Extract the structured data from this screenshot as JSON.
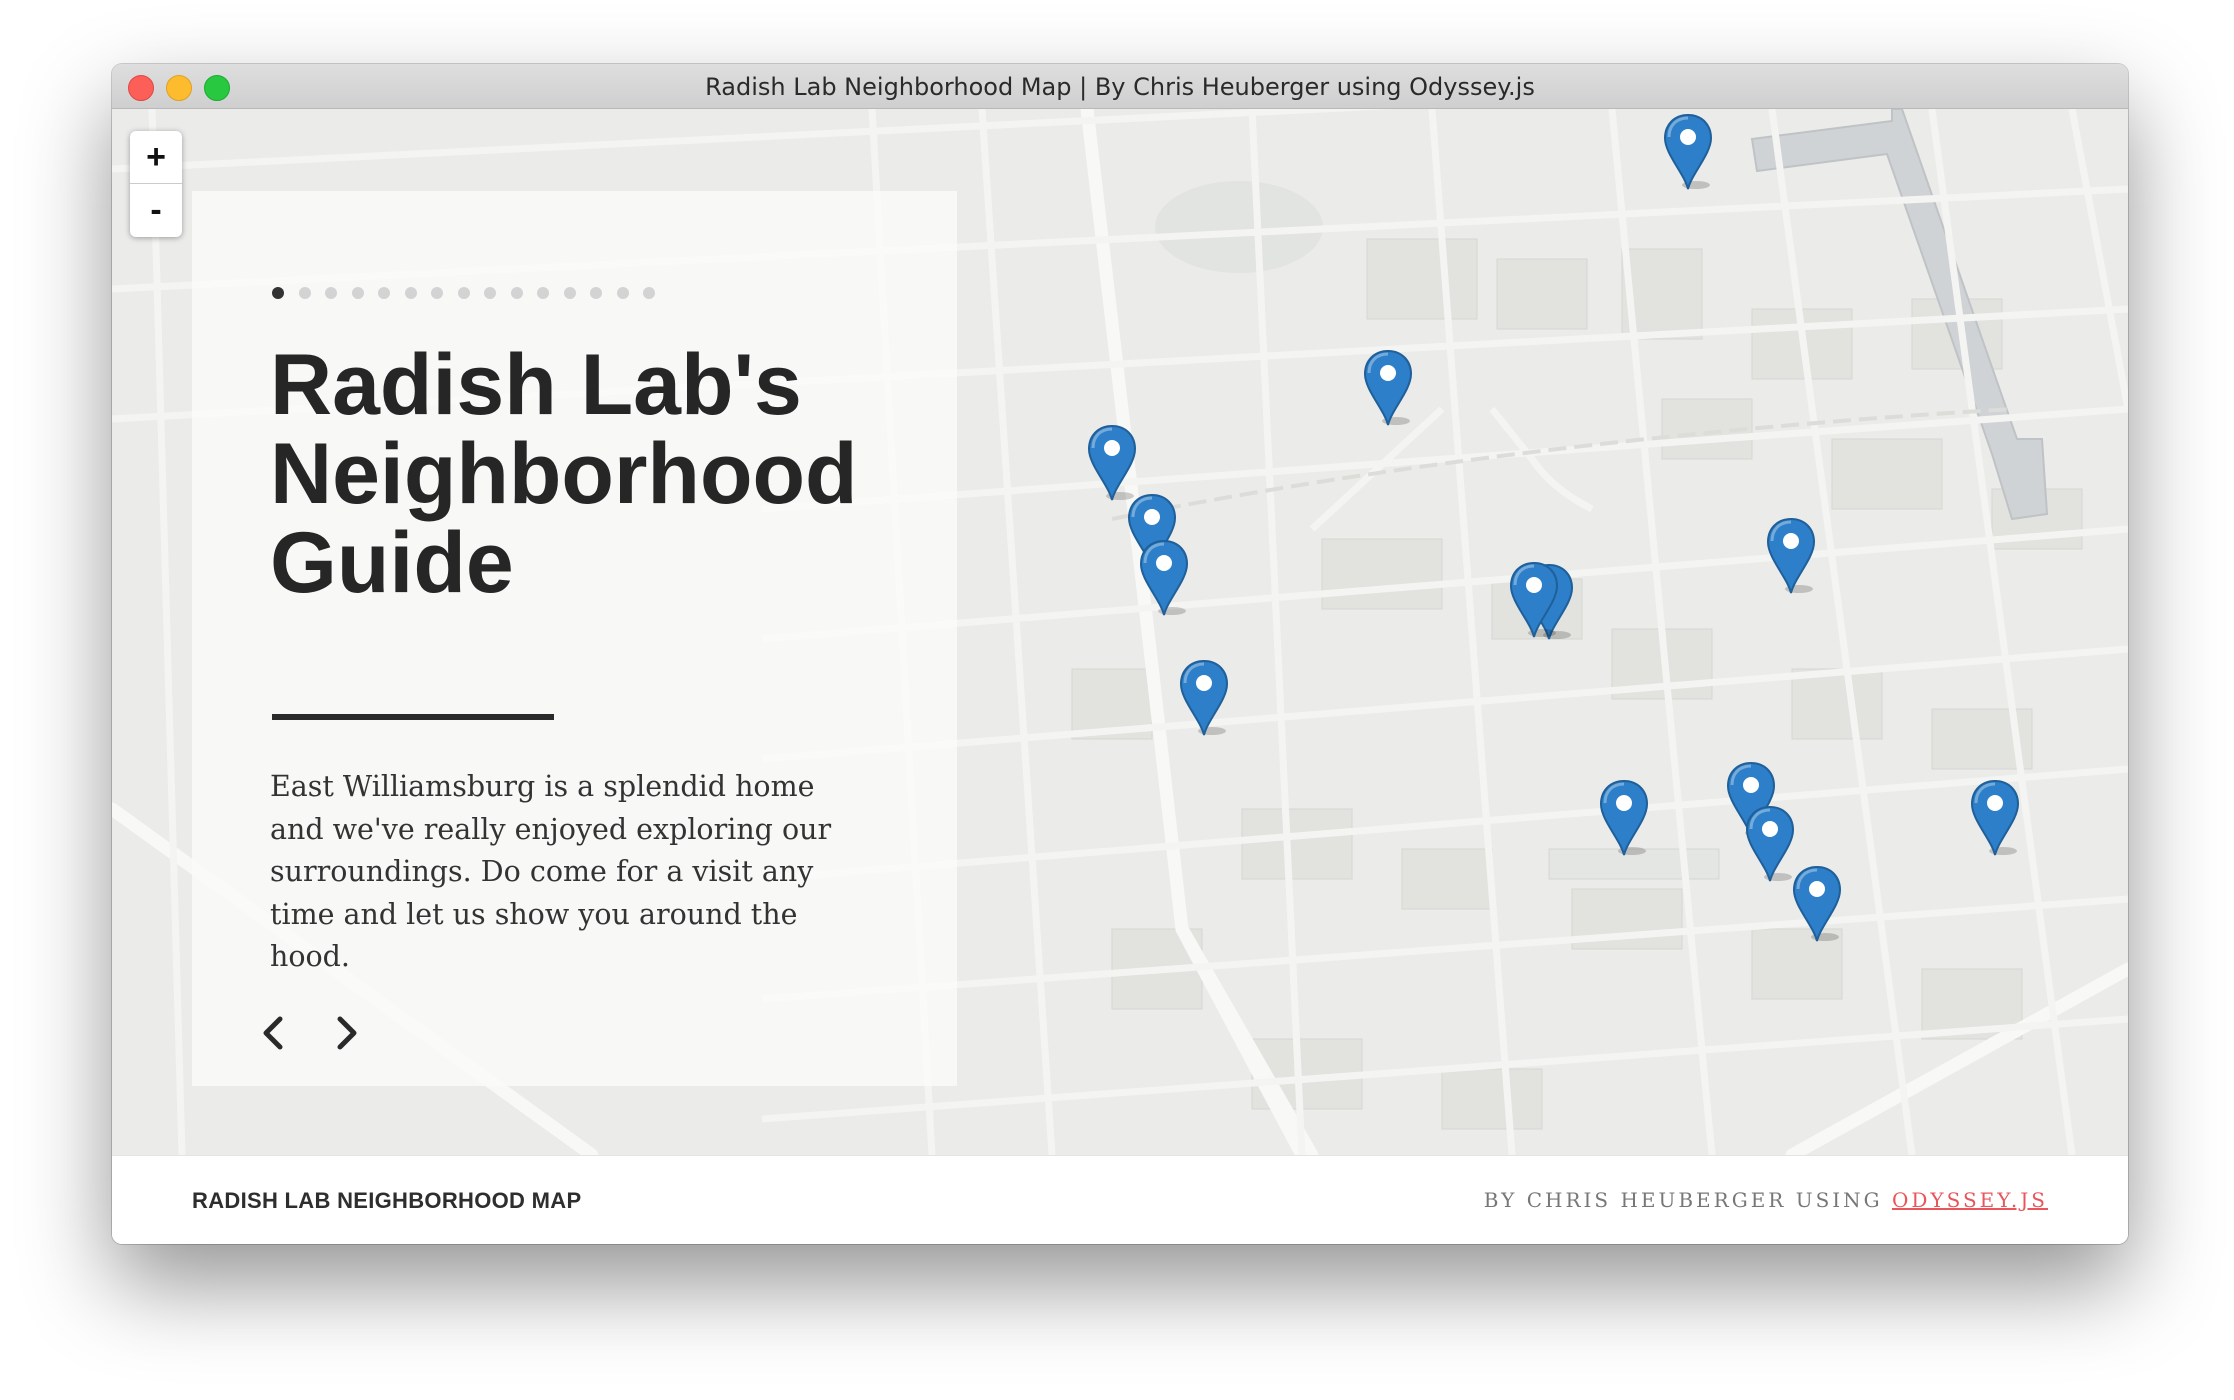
{
  "window": {
    "title": "Radish Lab Neighborhood Map | By Chris Heuberger using Odyssey.js"
  },
  "map": {
    "zoom_in_label": "+",
    "zoom_out_label": "-",
    "marker_color": "#2c7fc8"
  },
  "story": {
    "title": "Radish Lab's Neighborhood Guide",
    "text": "East Williamsburg is a splendid home and we've really enjoyed exploring our surroundings. Do come for a visit any time and let us show you around the hood.",
    "slide_count": 15,
    "active_slide": 1
  },
  "footer": {
    "left_label": "RADISH LAB NEIGHBORHOOD MAP",
    "right_prefix": "BY CHRIS HEUBERGER USING ",
    "right_link": "ODYSSEY.JS"
  },
  "colors": {
    "accent_link": "#e8555a",
    "title_text": "#262626"
  }
}
